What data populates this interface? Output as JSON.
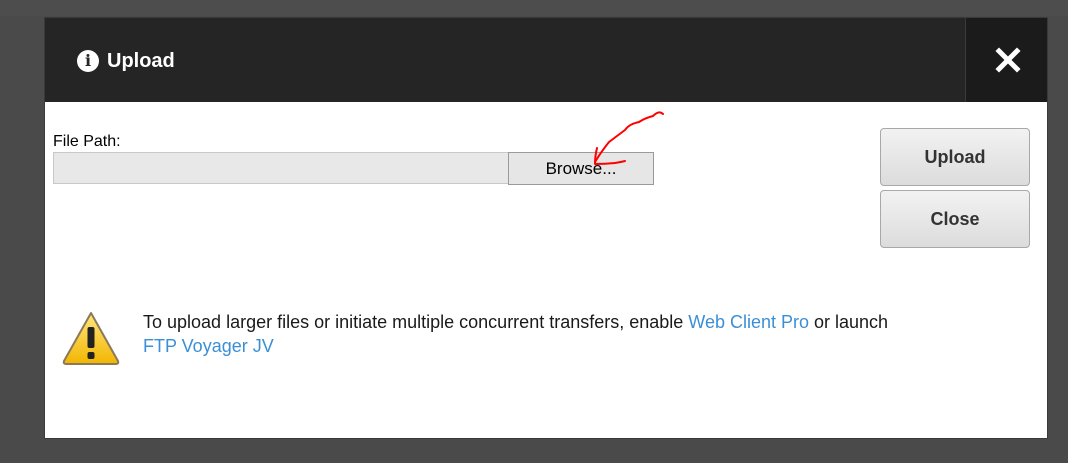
{
  "dialog": {
    "title": "Upload",
    "close_icon": "close-icon",
    "info_icon": "info-icon"
  },
  "form": {
    "file_path_label": "File Path:",
    "file_path_value": "",
    "browse_label": "Browse..."
  },
  "actions": {
    "upload_label": "Upload",
    "close_label": "Close"
  },
  "notice": {
    "icon": "warning-icon",
    "text_before": "To upload larger files or initiate multiple concurrent transfers, enable ",
    "link_web_client": "Web Client Pro",
    "text_middle": " or launch ",
    "link_ftp_voyager": "FTP Voyager JV"
  },
  "colors": {
    "titlebar": "#252525",
    "link": "#3b8fd6",
    "annotation_arrow": "#ff0000"
  }
}
